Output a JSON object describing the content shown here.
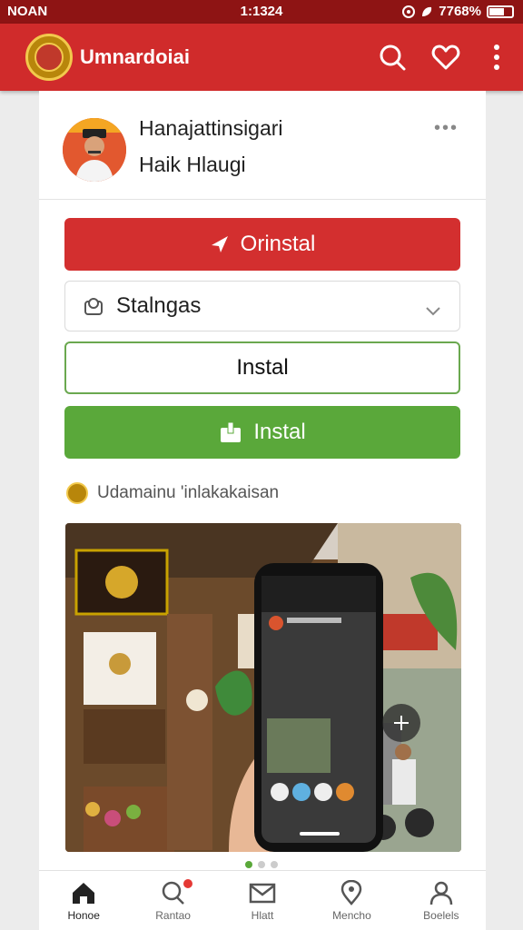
{
  "status_bar": {
    "carrier": "NOAN",
    "time": "1:1324",
    "battery": "7768%"
  },
  "app_bar": {
    "title": "Umnardoiai"
  },
  "profile": {
    "name": "Hanajattinsigari",
    "handle": "Haik Hlaugi"
  },
  "buttons": {
    "primary_label": "Orinstal",
    "select_label": "Stalngas",
    "outline_label": "Instal",
    "green_label": "Instal"
  },
  "caption": "Udamainu 'inlakakaisan",
  "bottom_nav": [
    {
      "label": "Honoe",
      "icon": "home-icon"
    },
    {
      "label": "Rantao",
      "icon": "search-icon"
    },
    {
      "label": "Hlatt",
      "icon": "mail-icon"
    },
    {
      "label": "Mencho",
      "icon": "location-icon"
    },
    {
      "label": "Boelels",
      "icon": "profile-icon"
    }
  ],
  "colors": {
    "header": "#d02b2b",
    "primary": "#d32f2f",
    "success": "#5aa83a",
    "status": "#8e1414"
  }
}
